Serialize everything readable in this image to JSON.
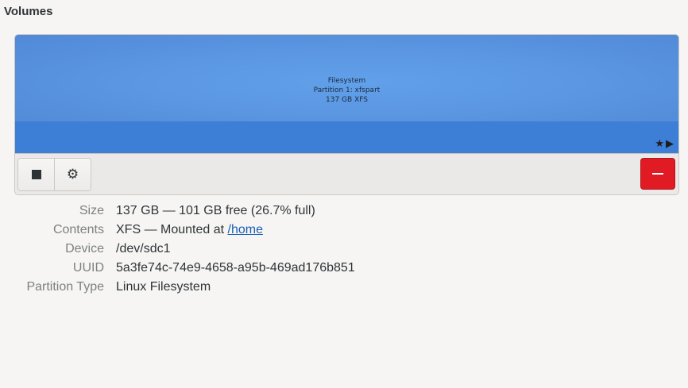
{
  "section_title": "Volumes",
  "partition": {
    "line1": "Filesystem",
    "line2": "Partition 1: xfspart",
    "line3": "137 GB XFS",
    "flags": "★▶",
    "fill_color": "#62a0ea",
    "bar_color": "#3d7ed6"
  },
  "toolbar": {
    "stop_icon": "stop-icon",
    "settings_icon": "gears-icon",
    "settings_glyph": "⚙",
    "delete_icon": "minus-icon",
    "delete_color": "#e01b24"
  },
  "properties": {
    "size": {
      "label": "Size",
      "value": "137 GB — 101 GB free (26.7% full)"
    },
    "contents": {
      "label": "Contents",
      "value_prefix": "XFS — Mounted at ",
      "link": "/home"
    },
    "device": {
      "label": "Device",
      "value": "/dev/sdc1"
    },
    "uuid": {
      "label": "UUID",
      "value": "5a3fe74c-74e9-4658-a95b-469ad176b851"
    },
    "partition_type": {
      "label": "Partition Type",
      "value": "Linux Filesystem"
    }
  }
}
